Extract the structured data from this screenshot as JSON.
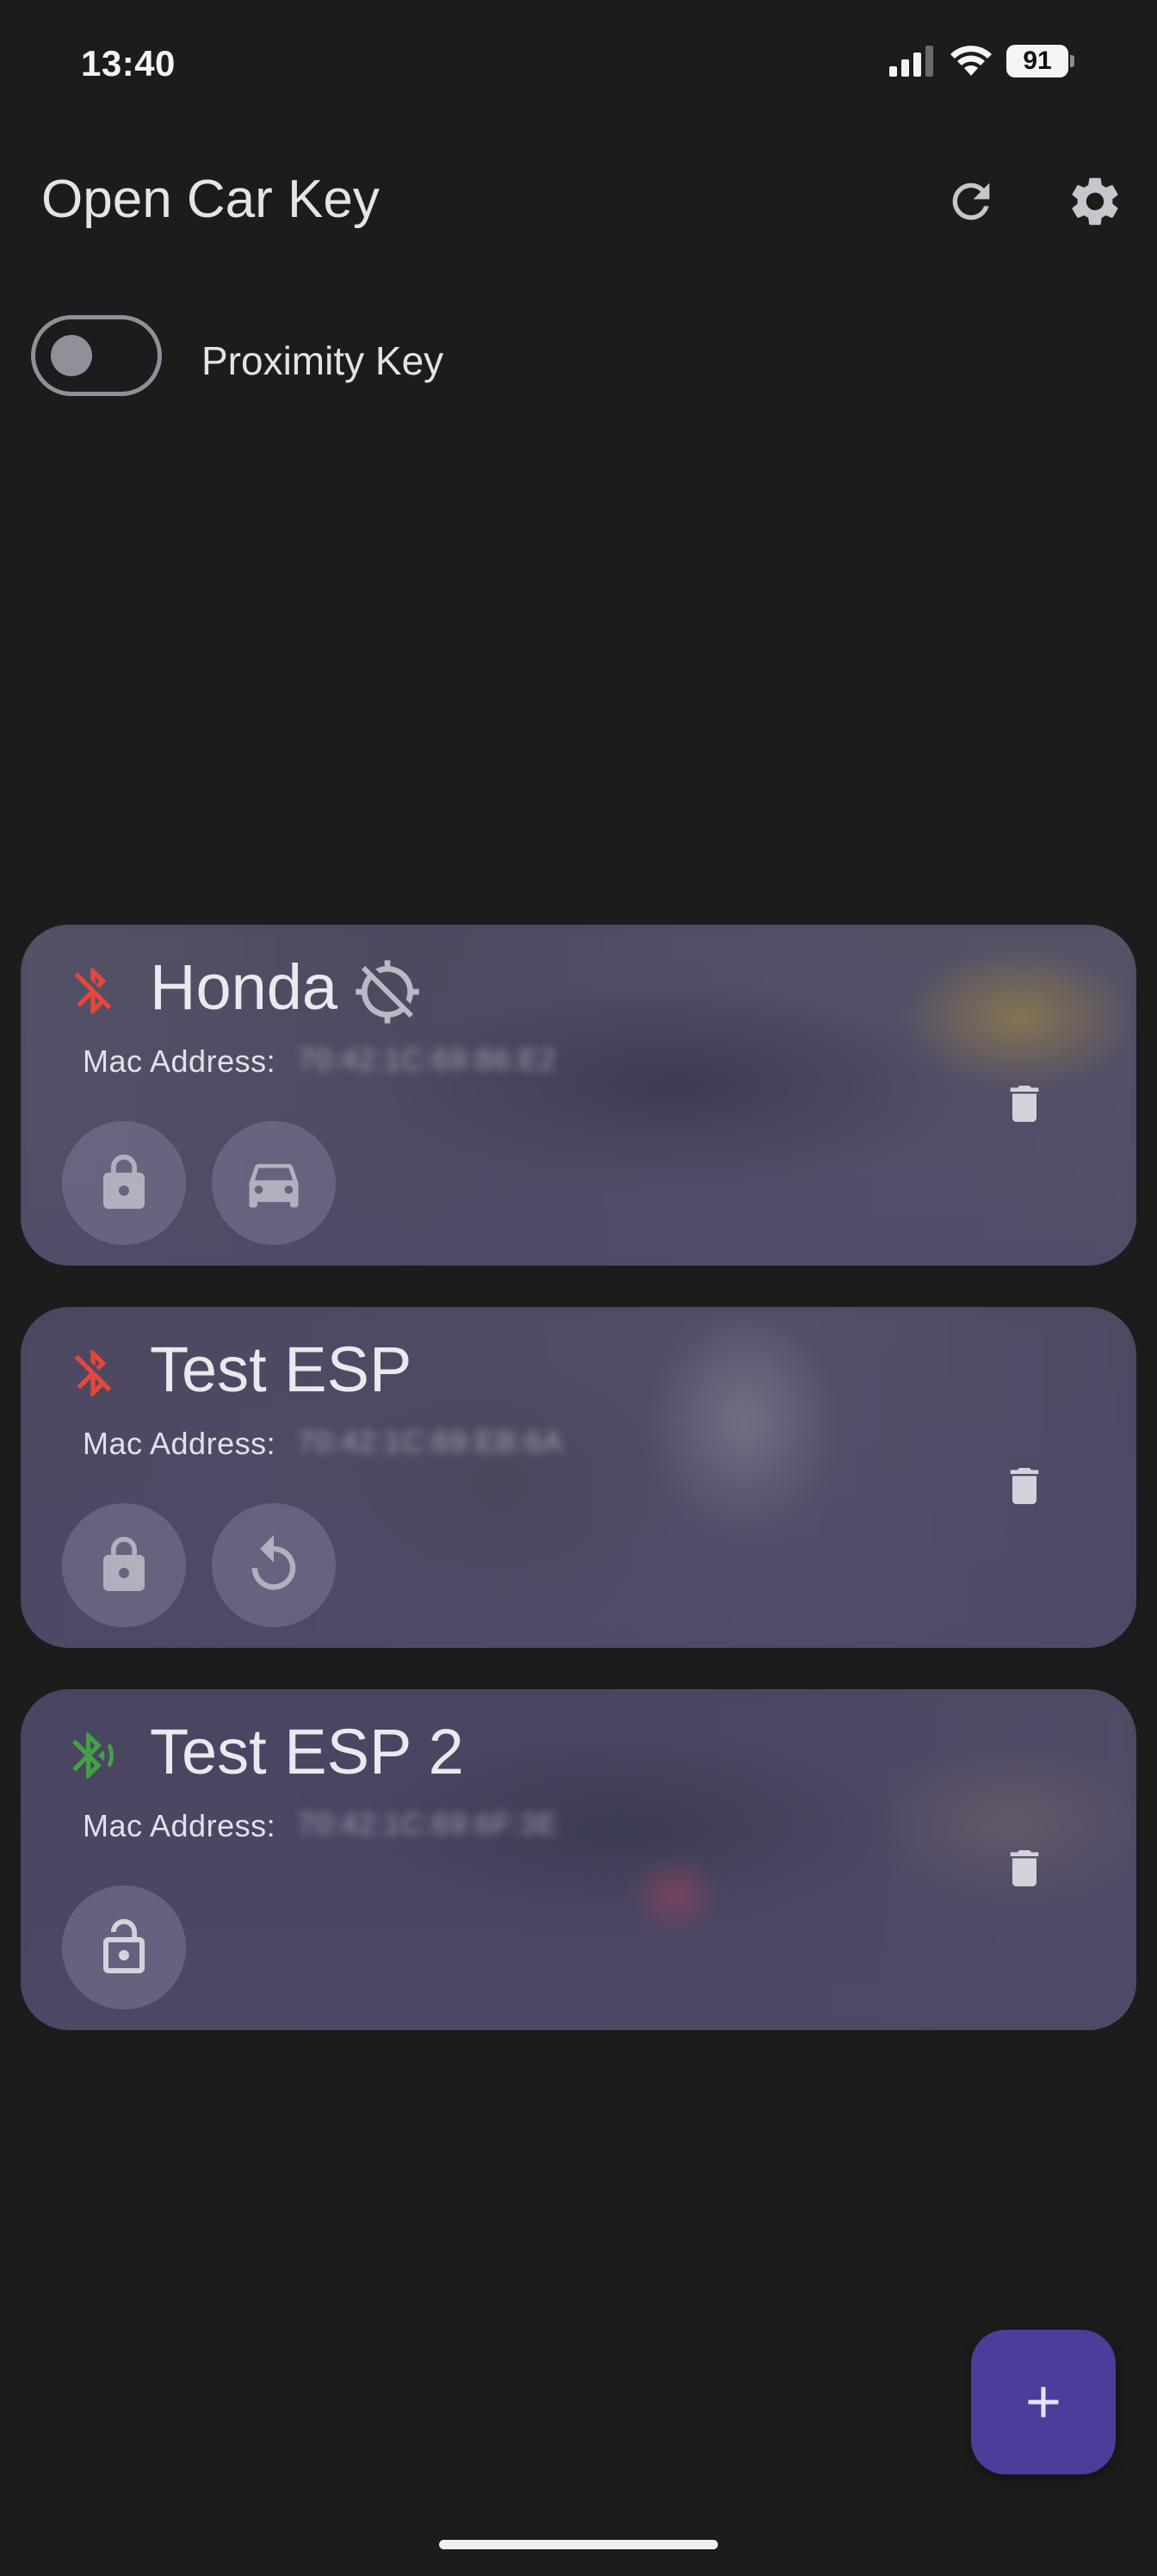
{
  "status_bar": {
    "time": "13:40",
    "battery": "91",
    "icons": [
      "signal-icon",
      "wifi-icon",
      "battery-icon"
    ]
  },
  "app_bar": {
    "title": "Open Car Key",
    "actions": [
      "refresh-icon",
      "settings-icon"
    ]
  },
  "proximity": {
    "label": "Proximity Key",
    "enabled": false
  },
  "colors": {
    "background": "#1c1c1d",
    "card": "#4a4560",
    "bt_disconnected": "#e5473a",
    "bt_connected": "#43a047",
    "fab": "#4d3d9a"
  },
  "devices": [
    {
      "name": "Honda",
      "mac_label": "Mac Address:",
      "mac_value": "70:42:1C:69:86:E2",
      "bluetooth": "disconnected",
      "extra_icon": "gps-off-icon",
      "actions": [
        "lock-icon",
        "car-icon"
      ]
    },
    {
      "name": "Test ESP",
      "mac_label": "Mac Address:",
      "mac_value": "70:42:1C:69:EB:6A",
      "bluetooth": "disconnected",
      "actions": [
        "lock-icon",
        "reset-icon"
      ]
    },
    {
      "name": "Test ESP 2",
      "mac_label": "Mac Address:",
      "mac_value": "70:42:1C:69:6F:3E",
      "bluetooth": "connected",
      "actions": [
        "lock-open-icon"
      ]
    }
  ],
  "fab": {
    "icon": "add-icon"
  }
}
